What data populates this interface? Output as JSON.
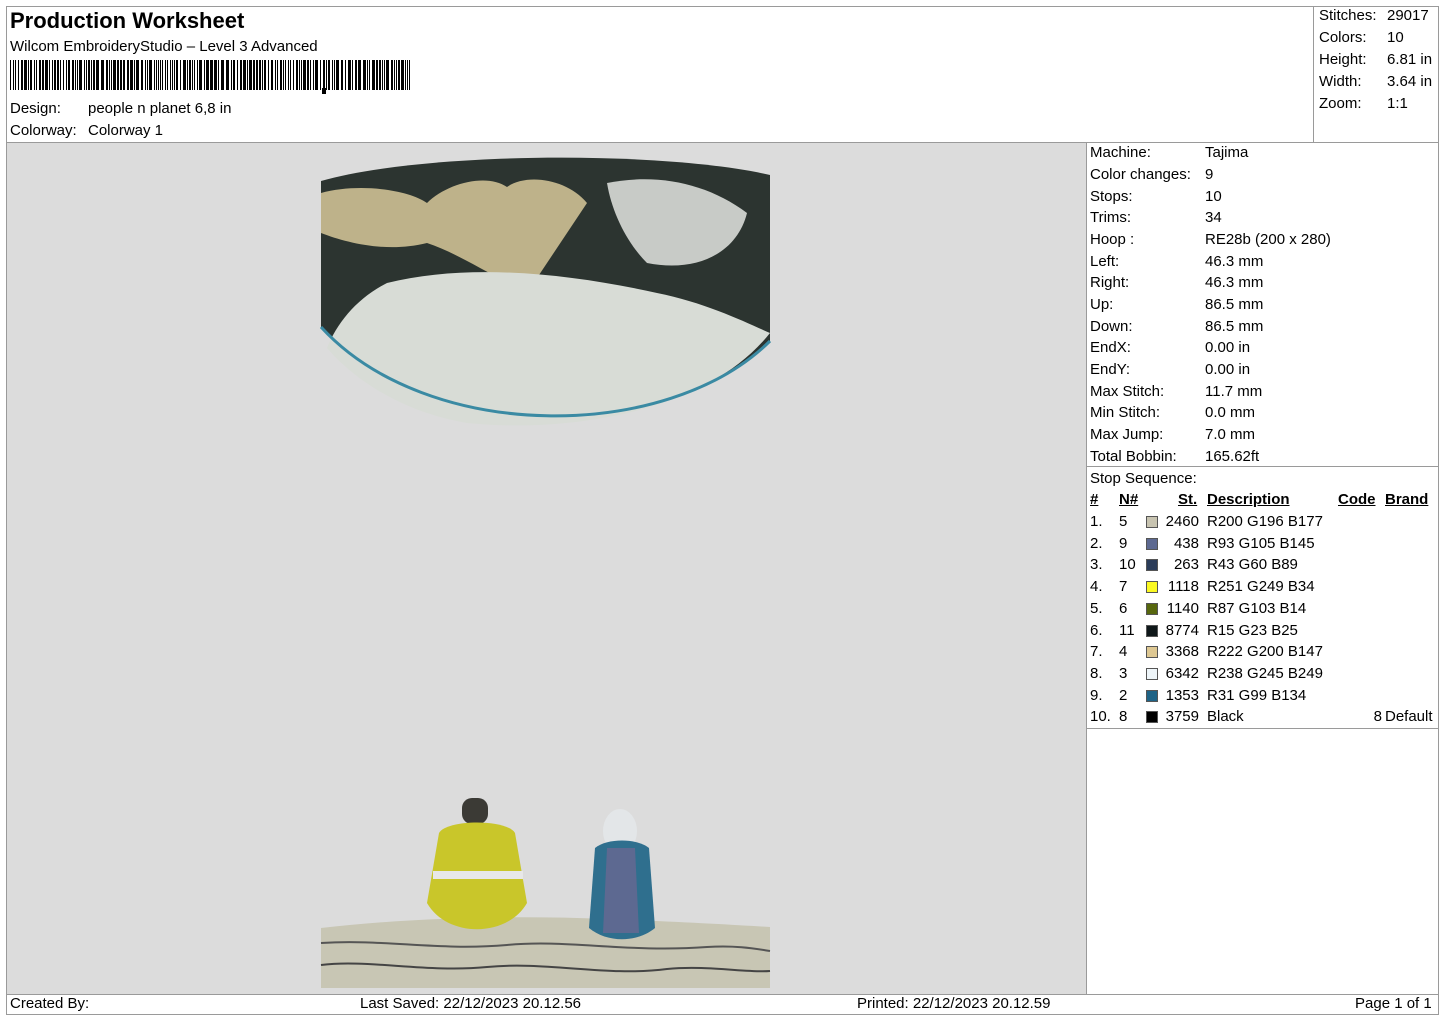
{
  "header": {
    "title": "Production Worksheet",
    "subtitle": "Wilcom EmbroideryStudio – Level 3 Advanced",
    "design_label": "Design:",
    "design_value": "people n planet 6,8 in",
    "colorway_label": "Colorway:",
    "colorway_value": "Colorway 1"
  },
  "stats": [
    {
      "label": "Stitches:",
      "value": "29017"
    },
    {
      "label": "Colors:",
      "value": "10"
    },
    {
      "label": "Height:",
      "value": "6.81 in"
    },
    {
      "label": "Width:",
      "value": "3.64 in"
    },
    {
      "label": "Zoom:",
      "value": "1:1"
    }
  ],
  "machine": [
    {
      "label": "Machine:",
      "value": "Tajima"
    },
    {
      "label": "Color changes:",
      "value": "9"
    },
    {
      "label": "Stops:",
      "value": "10"
    },
    {
      "label": "Trims:",
      "value": "34"
    },
    {
      "label": "Hoop :",
      "value": "RE28b (200 x 280)"
    },
    {
      "label": "Left:",
      "value": "46.3 mm"
    },
    {
      "label": "Right:",
      "value": "46.3 mm"
    },
    {
      "label": "Up:",
      "value": "86.5 mm"
    },
    {
      "label": "Down:",
      "value": "86.5 mm"
    },
    {
      "label": "EndX:",
      "value": "0.00 in"
    },
    {
      "label": "EndY:",
      "value": "0.00 in"
    },
    {
      "label": "Max Stitch:",
      "value": "11.7 mm"
    },
    {
      "label": "Min Stitch:",
      "value": "0.0 mm"
    },
    {
      "label": "Max Jump:",
      "value": "7.0 mm"
    },
    {
      "label": "Total Bobbin:",
      "value": "165.62ft"
    }
  ],
  "stop_sequence": {
    "title": "Stop Sequence:",
    "columns": {
      "num": "#",
      "needle": "N#",
      "st": "St.",
      "desc": "Description",
      "code": "Code",
      "brand": "Brand"
    },
    "rows": [
      {
        "num": "1.",
        "needle": "5",
        "color": "#C8C4B1",
        "st": "2460",
        "desc": "R200 G196 B177",
        "code": "",
        "brand": ""
      },
      {
        "num": "2.",
        "needle": "9",
        "color": "#5D6991",
        "st": "438",
        "desc": "R93 G105 B145",
        "code": "",
        "brand": ""
      },
      {
        "num": "3.",
        "needle": "10",
        "color": "#2B3C59",
        "st": "263",
        "desc": "R43 G60 B89",
        "code": "",
        "brand": ""
      },
      {
        "num": "4.",
        "needle": "7",
        "color": "#FBF922",
        "st": "1118",
        "desc": "R251 G249 B34",
        "code": "",
        "brand": ""
      },
      {
        "num": "5.",
        "needle": "6",
        "color": "#57670E",
        "st": "1140",
        "desc": "R87 G103 B14",
        "code": "",
        "brand": ""
      },
      {
        "num": "6.",
        "needle": "11",
        "color": "#0F1719",
        "st": "8774",
        "desc": "R15 G23 B25",
        "code": "",
        "brand": ""
      },
      {
        "num": "7.",
        "needle": "4",
        "color": "#DEC893",
        "st": "3368",
        "desc": "R222 G200 B147",
        "code": "",
        "brand": ""
      },
      {
        "num": "8.",
        "needle": "3",
        "color": "#EEF5F9",
        "st": "6342",
        "desc": "R238 G245 B249",
        "code": "",
        "brand": ""
      },
      {
        "num": "9.",
        "needle": "2",
        "color": "#1F6386",
        "st": "1353",
        "desc": "R31 G99 B134",
        "code": "",
        "brand": ""
      },
      {
        "num": "10.",
        "needle": "8",
        "color": "#000000",
        "st": "3759",
        "desc": "Black",
        "code": "8",
        "brand": "Default"
      }
    ]
  },
  "footer": {
    "created_by": "Created By:",
    "last_saved": "Last Saved: 22/12/2023 20.12.56",
    "printed": "Printed: 22/12/2023 20.12.59",
    "page": "Page 1 of 1"
  }
}
